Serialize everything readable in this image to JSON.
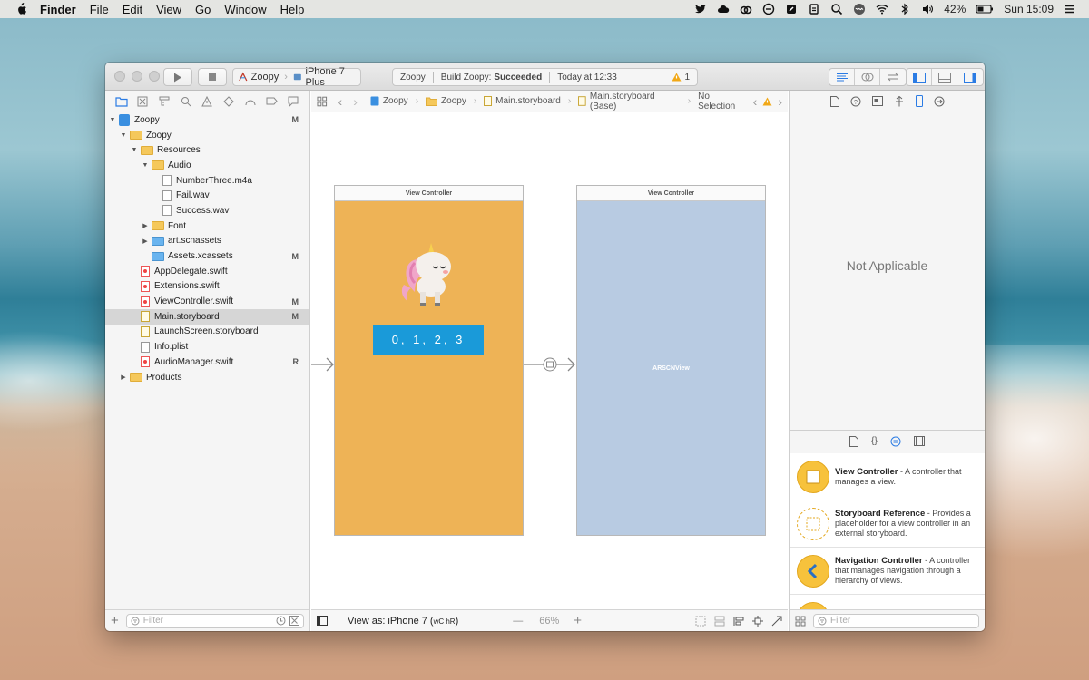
{
  "menubar": {
    "app": "Finder",
    "items": [
      "File",
      "Edit",
      "View",
      "Go",
      "Window",
      "Help"
    ],
    "battery": "42%",
    "clock": "Sun 15:09"
  },
  "toolbar": {
    "scheme_project": "Zoopy",
    "scheme_device": "iPhone 7 Plus",
    "activity_project": "Zoopy",
    "activity_status_prefix": "Build Zoopy:",
    "activity_status": "Succeeded",
    "activity_time": "Today at 12:33",
    "warning_count": "1"
  },
  "navigator": {
    "rows": [
      {
        "label": "Zoopy",
        "badge": "M",
        "indent": 0,
        "kind": "project",
        "disc": "▼"
      },
      {
        "label": "Zoopy",
        "badge": "",
        "indent": 1,
        "kind": "folder",
        "disc": "▼"
      },
      {
        "label": "Resources",
        "badge": "",
        "indent": 2,
        "kind": "folder",
        "disc": "▼"
      },
      {
        "label": "Audio",
        "badge": "",
        "indent": 3,
        "kind": "folder",
        "disc": "▼"
      },
      {
        "label": "NumberThree.m4a",
        "badge": "",
        "indent": 4,
        "kind": "file",
        "disc": ""
      },
      {
        "label": "Fail.wav",
        "badge": "",
        "indent": 4,
        "kind": "file",
        "disc": ""
      },
      {
        "label": "Success.wav",
        "badge": "",
        "indent": 4,
        "kind": "file",
        "disc": ""
      },
      {
        "label": "Font",
        "badge": "",
        "indent": 3,
        "kind": "folder",
        "disc": "▶"
      },
      {
        "label": "art.scnassets",
        "badge": "",
        "indent": 3,
        "kind": "blue",
        "disc": "▶"
      },
      {
        "label": "Assets.xcassets",
        "badge": "M",
        "indent": 3,
        "kind": "blue",
        "disc": ""
      },
      {
        "label": "AppDelegate.swift",
        "badge": "",
        "indent": 2,
        "kind": "swift",
        "disc": ""
      },
      {
        "label": "Extensions.swift",
        "badge": "",
        "indent": 2,
        "kind": "swift",
        "disc": ""
      },
      {
        "label": "ViewController.swift",
        "badge": "M",
        "indent": 2,
        "kind": "swift",
        "disc": ""
      },
      {
        "label": "Main.storyboard",
        "badge": "M",
        "indent": 2,
        "kind": "sb",
        "disc": "",
        "selected": true
      },
      {
        "label": "LaunchScreen.storyboard",
        "badge": "",
        "indent": 2,
        "kind": "sb",
        "disc": ""
      },
      {
        "label": "Info.plist",
        "badge": "",
        "indent": 2,
        "kind": "file",
        "disc": ""
      },
      {
        "label": "AudioManager.swift",
        "badge": "R",
        "indent": 2,
        "kind": "swift",
        "disc": ""
      },
      {
        "label": "Products",
        "badge": "",
        "indent": 1,
        "kind": "folder",
        "disc": "▶"
      }
    ],
    "filter_placeholder": "Filter"
  },
  "jumpbar": {
    "crumbs": [
      "Zoopy",
      "Zoopy",
      "Main.storyboard",
      "Main.storyboard (Base)",
      "No Selection"
    ]
  },
  "canvas": {
    "vc1_title": "View Controller",
    "vc2_title": "View Controller",
    "button_label": "0, 1, 2, 3",
    "arscn_label": "ARSCNView"
  },
  "editor_footer": {
    "view_as": "View as: iPhone 7 (",
    "size_class": "wC hR",
    "close_paren": ")",
    "zoom_minus": "—",
    "zoom": "66%",
    "zoom_plus": "+"
  },
  "inspector": {
    "not_applicable": "Not Applicable",
    "library": [
      {
        "title": "View Controller",
        "desc": " - A controller that manages a view."
      },
      {
        "title": "Storyboard Reference",
        "desc": " - Provides a placeholder for a view controller in an external storyboard."
      },
      {
        "title": "Navigation Controller",
        "desc": " - A controller that manages navigation through a hierarchy of views."
      }
    ],
    "filter_placeholder": "Filter"
  }
}
